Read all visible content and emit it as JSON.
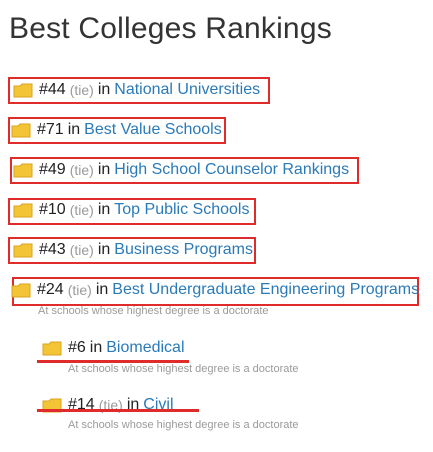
{
  "page": {
    "title": "Best Colleges Rankings"
  },
  "colors": {
    "link": "#2a7ab8",
    "highlight": "#e02b2b",
    "folder": "#f3c436",
    "muted": "#9a9a9a"
  },
  "icon": "folder-icon",
  "rankings": [
    {
      "rank": "#44",
      "tie": "(tie)",
      "in": "in",
      "category": "National Universities"
    },
    {
      "rank": "#71",
      "tie": "",
      "in": "in",
      "category": "Best Value Schools"
    },
    {
      "rank": "#49",
      "tie": "(tie)",
      "in": "in",
      "category": "High School Counselor Rankings"
    },
    {
      "rank": "#10",
      "tie": "(tie)",
      "in": "in",
      "category": "Top Public Schools"
    },
    {
      "rank": "#43",
      "tie": "(tie)",
      "in": "in",
      "category": "Business Programs"
    },
    {
      "rank": "#24",
      "tie": "(tie)",
      "in": "in",
      "category": "Best Undergraduate Engineering Programs",
      "note": "At schools whose highest degree is a doctorate"
    }
  ],
  "subrankings": [
    {
      "rank": "#6",
      "tie": "",
      "in": "in",
      "category": "Biomedical",
      "note": "At schools whose highest degree is a doctorate"
    },
    {
      "rank": "#14",
      "tie": "(tie)",
      "in": "in",
      "category": "Civil",
      "note": "At schools whose highest degree is a doctorate"
    }
  ]
}
